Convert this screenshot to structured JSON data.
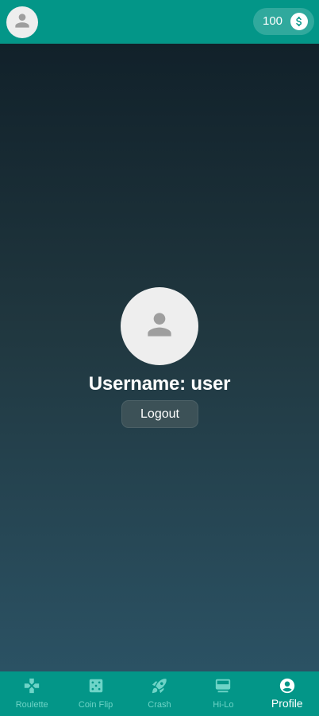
{
  "header": {
    "avatar_icon": "account-icon",
    "balance": "100",
    "currency_icon": "dollar-coin-icon"
  },
  "profile": {
    "avatar_icon": "account-icon",
    "username_text": "Username: user",
    "logout_label": "Logout"
  },
  "bottom_nav": {
    "items": [
      {
        "label": "Roulette",
        "icon": "gamepad-icon",
        "active": false
      },
      {
        "label": "Coin Flip",
        "icon": "dice-icon",
        "active": false
      },
      {
        "label": "Crash",
        "icon": "rocket-icon",
        "active": false
      },
      {
        "label": "Hi-Lo",
        "icon": "card-icon",
        "active": false
      },
      {
        "label": "Profile",
        "icon": "account-circle-icon",
        "active": true
      }
    ]
  },
  "colors": {
    "primary": "#039688",
    "inactive_nav": "#6ed4c7",
    "active_nav": "#ffffff",
    "avatar_bg": "#eeeeee",
    "avatar_glyph": "#9e9e9e"
  }
}
